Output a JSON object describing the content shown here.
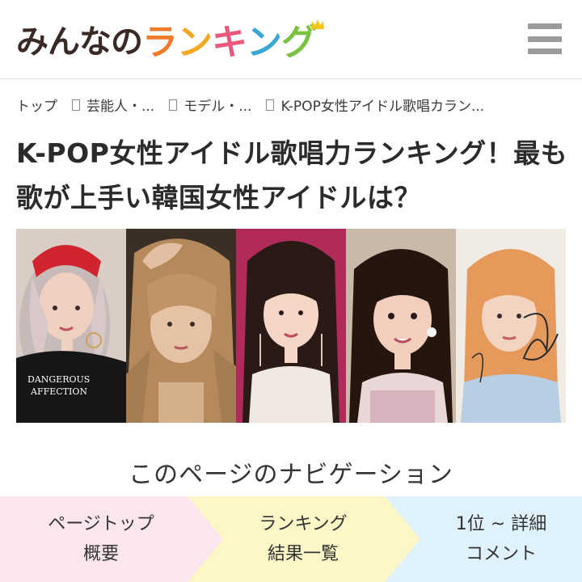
{
  "header": {
    "logo_part1": "みんなの",
    "logo_chars": [
      {
        "char": "ラ",
        "color": "#f07b2a"
      },
      {
        "char": "ン",
        "color": "#f5a623"
      },
      {
        "char": "キ",
        "color": "#e8587c"
      },
      {
        "char": "ン",
        "color": "#3aa7d8"
      },
      {
        "char": "グ",
        "color": "#7cc242"
      }
    ],
    "crown_color": "#f5c518"
  },
  "breadcrumb": {
    "items": [
      "トップ",
      "芸能人・...",
      "モデル・...",
      "K-POP女性アイドル歌唱カラン..."
    ]
  },
  "title": "K-POP女性アイドル歌唱力ランキング！最も歌が上手い韓国女性アイドルは？",
  "hero": {
    "shirt_text_line1": "DANGEROUS",
    "shirt_text_line2": "AFFECTION"
  },
  "navigation": {
    "heading": "このページのナビゲーション",
    "items": [
      {
        "line1": "ページトップ",
        "line2": "概要",
        "color": "#fbe6ee"
      },
      {
        "line1": "ランキング",
        "line2": "結果一覧",
        "color": "#fdf7c8"
      },
      {
        "line1": "1位 ~ 詳細",
        "line2": "コメント",
        "color": "#dff1fa"
      }
    ]
  }
}
